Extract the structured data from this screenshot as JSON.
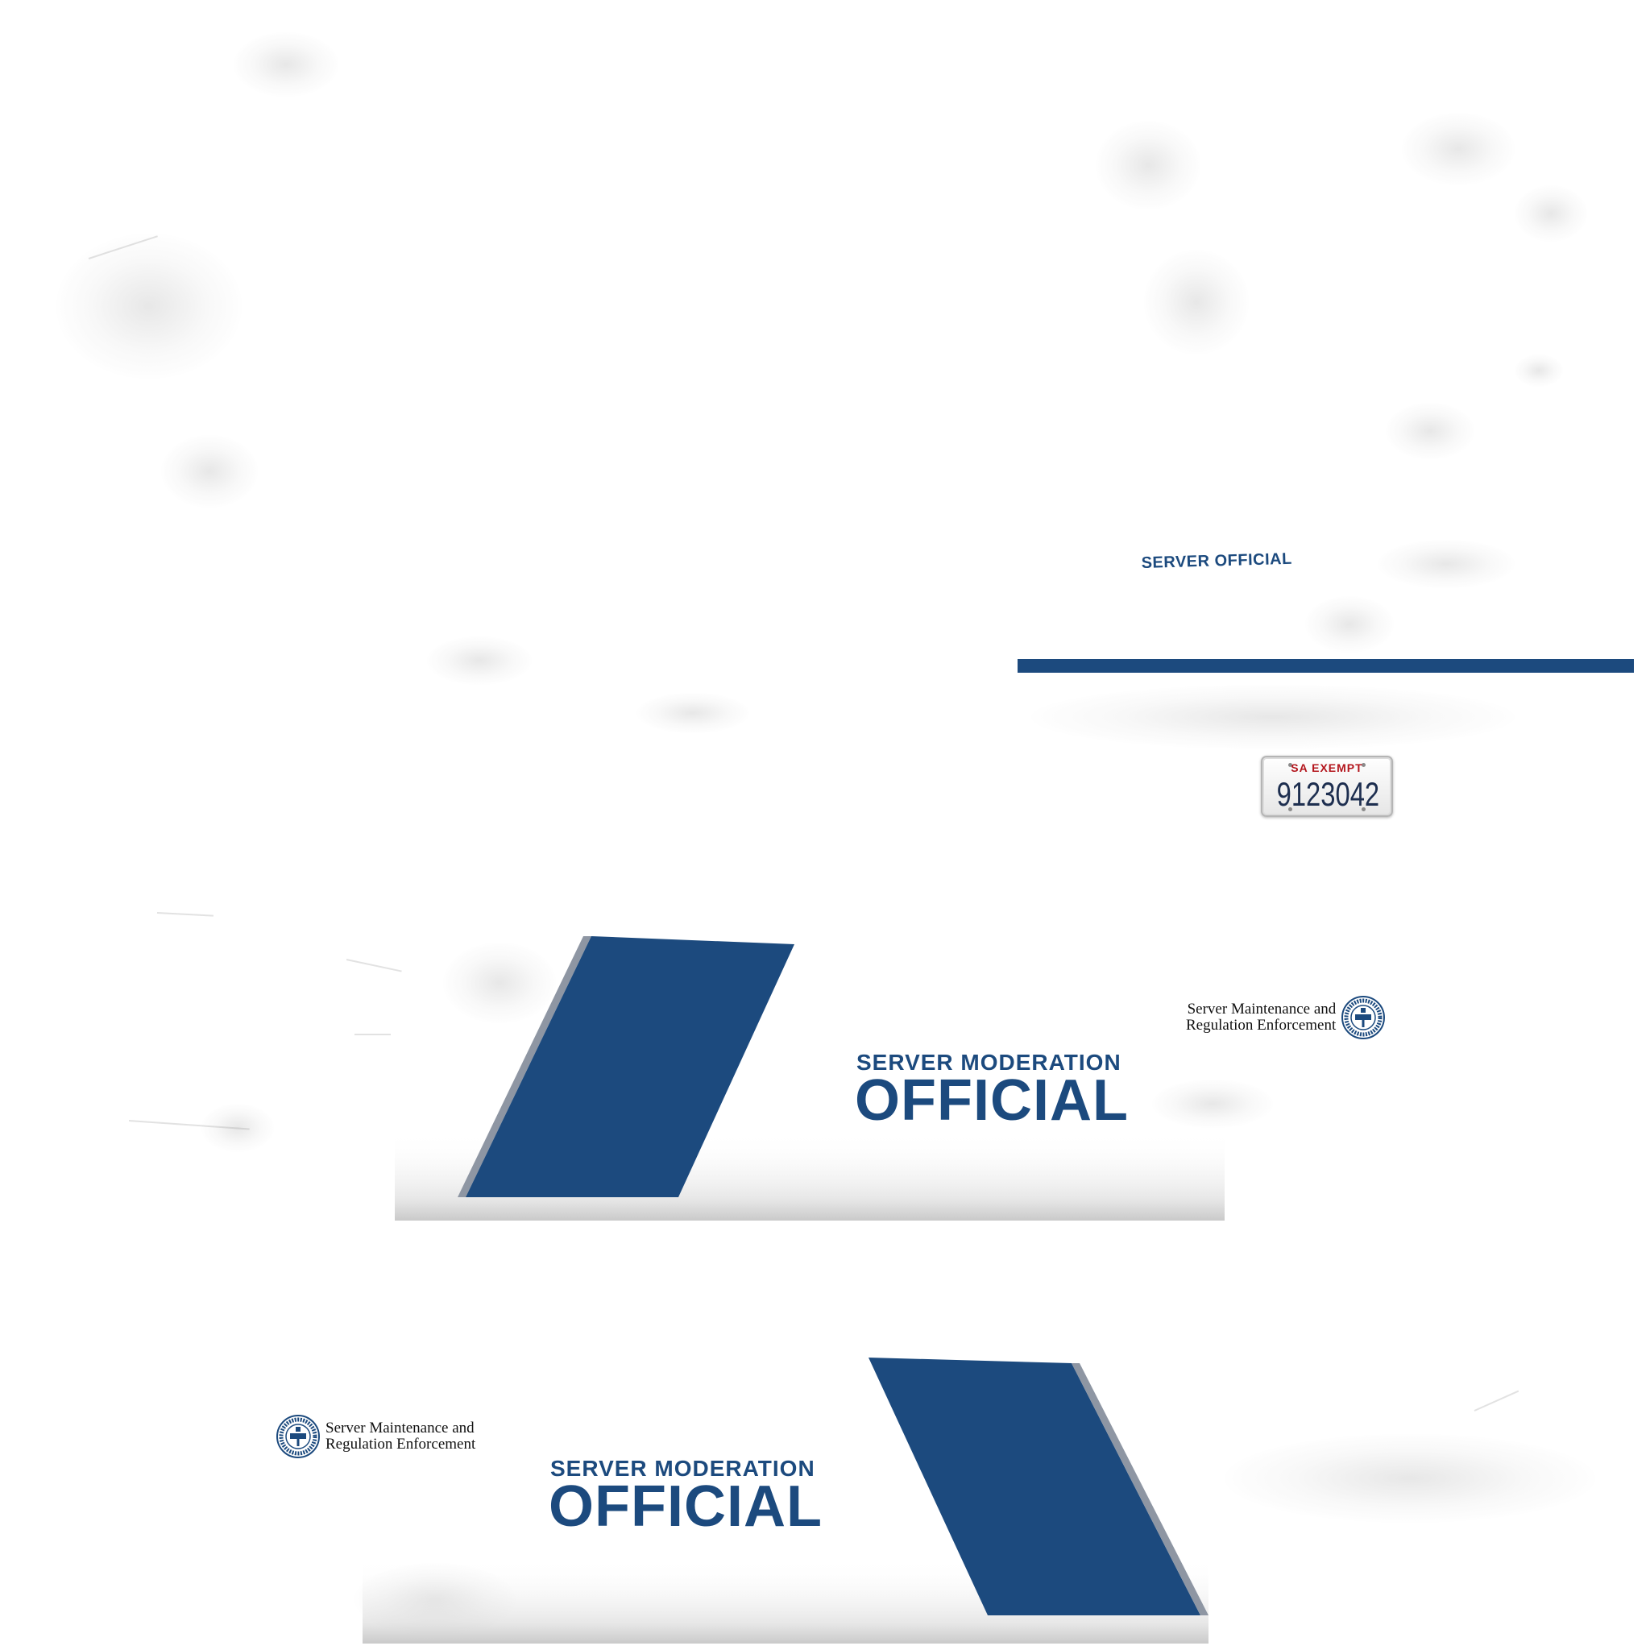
{
  "colors": {
    "brand_blue": "#1c4a7e",
    "stripe_edge": "#8e96a3",
    "plate_red": "#b3151c",
    "plate_navy": "#1d2e4f",
    "background": "#ffffff"
  },
  "top_section": {
    "label": "SERVER OFFICIAL"
  },
  "license_plate": {
    "header": "SA  EXEMPT",
    "number": "9123042"
  },
  "upper_panel": {
    "title_small": "SERVER MODERATION",
    "title_big": "OFFICIAL",
    "agency_line1": "Server Maintenance and",
    "agency_line2": "Regulation Enforcement",
    "seal_icon": "agency-seal-icon"
  },
  "lower_panel": {
    "title_small": "SERVER MODERATION",
    "title_big": "OFFICIAL",
    "agency_line1": "Server Maintenance and",
    "agency_line2": "Regulation Enforcement",
    "seal_icon": "agency-seal-icon"
  }
}
